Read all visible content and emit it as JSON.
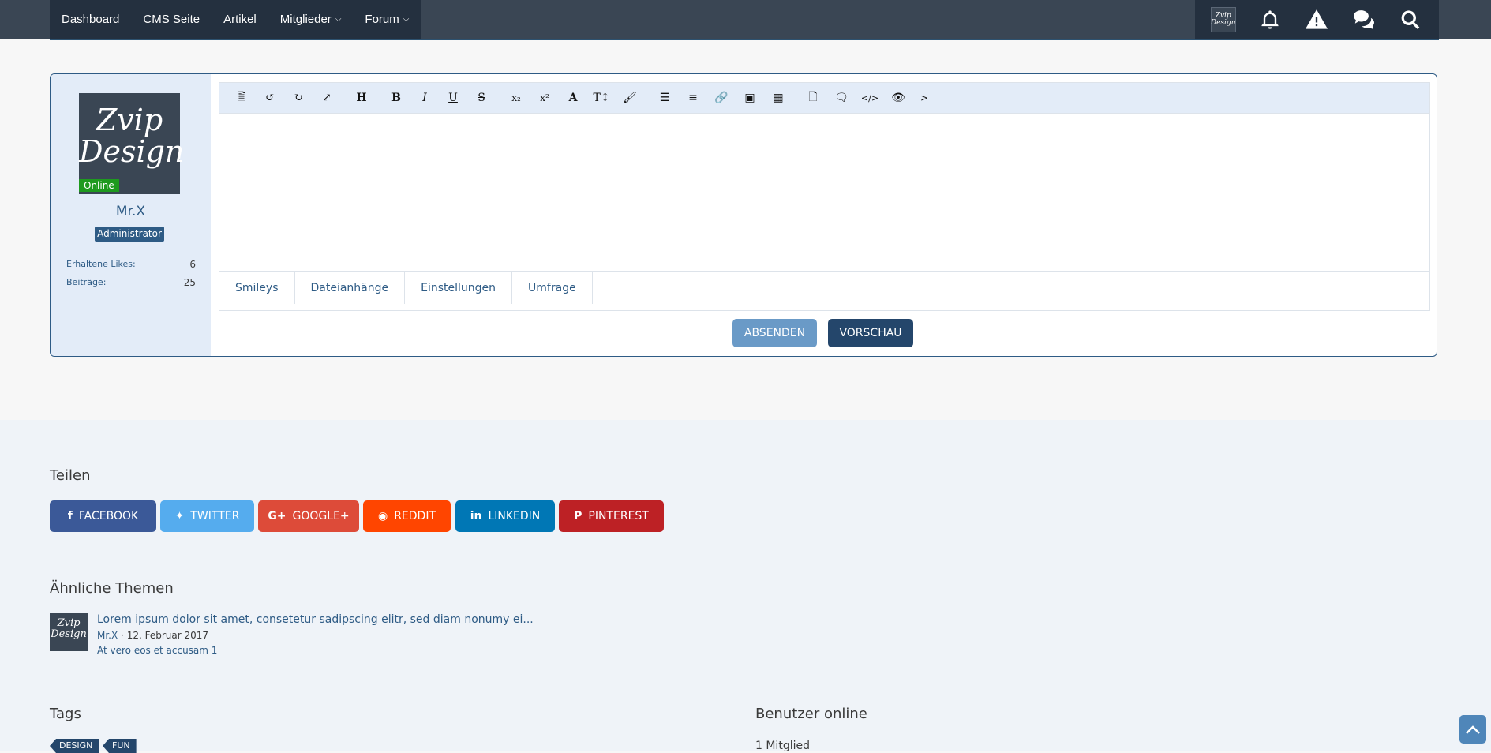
{
  "nav": {
    "items": [
      {
        "label": "Dashboard",
        "dropdown": false
      },
      {
        "label": "CMS Seite",
        "dropdown": false
      },
      {
        "label": "Artikel",
        "dropdown": false
      },
      {
        "label": "Mitglieder",
        "dropdown": true
      },
      {
        "label": "Forum",
        "dropdown": true
      }
    ],
    "avatar_text": "Zvip Design",
    "icons": [
      "bell-icon",
      "warning-icon",
      "conversations-icon",
      "search-icon"
    ]
  },
  "user": {
    "avatar_text": "Zvip Design",
    "online_label": "Online",
    "name": "Mr.X",
    "role": "Administrator",
    "stats": [
      {
        "label": "Erhaltene Likes:",
        "value": "6"
      },
      {
        "label": "Beiträge:",
        "value": "25"
      }
    ]
  },
  "editor": {
    "toolbar_icons": [
      "source-icon",
      "undo-icon",
      "redo-icon",
      "fullscreen-icon",
      "heading-icon",
      "bold-icon",
      "italic-icon",
      "underline-icon",
      "strikethrough-icon",
      "subscript-icon",
      "superscript-icon",
      "font-color-icon",
      "font-size-icon",
      "paintbrush-icon",
      "list-icon",
      "align-icon",
      "link-icon",
      "image-icon",
      "table-icon",
      "page-icon",
      "quote-icon",
      "code-icon",
      "spoiler-icon",
      "inline-code-icon"
    ],
    "tabs": [
      "Smileys",
      "Dateianhänge",
      "Einstellungen",
      "Umfrage"
    ],
    "submit_label": "ABSENDEN",
    "preview_label": "VORSCHAU"
  },
  "share": {
    "heading": "Teilen",
    "buttons": [
      {
        "label": "FACEBOOK",
        "color": "#3b5998",
        "icon": "facebook-icon"
      },
      {
        "label": "TWITTER",
        "color": "#55acee",
        "icon": "twitter-icon"
      },
      {
        "label": "GOOGLE+",
        "color": "#dd4b39",
        "icon": "googleplus-icon"
      },
      {
        "label": "REDDIT",
        "color": "#ff4500",
        "icon": "reddit-icon"
      },
      {
        "label": "LINKEDIN",
        "color": "#0077b5",
        "icon": "linkedin-icon"
      },
      {
        "label": "PINTEREST",
        "color": "#bd2125",
        "icon": "pinterest-icon"
      }
    ]
  },
  "similar": {
    "heading": "Ähnliche Themen",
    "items": [
      {
        "avatar_text": "Zvip Design",
        "title": "Lorem ipsum dolor sit amet, consetetur sadipscing elitr, sed diam nonumy ei...",
        "author": "Mr.X",
        "date": "12. Februar 2017",
        "board": "At vero eos et accusam 1"
      }
    ]
  },
  "tags": {
    "heading": "Tags",
    "items": [
      "DESIGN",
      "FUN"
    ]
  },
  "online": {
    "heading": "Benutzer online",
    "count": "1 Mitglied"
  }
}
